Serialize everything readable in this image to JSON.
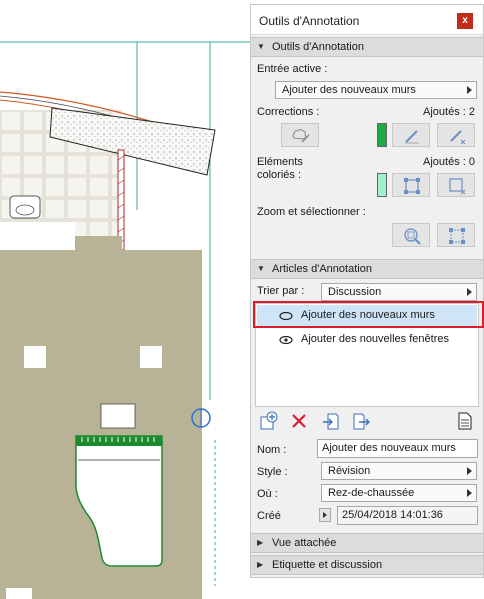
{
  "palette": {
    "title": "Outils d'Annotation",
    "close_label": "x"
  },
  "tools_section": {
    "header": "Outils d'Annotation",
    "active_entry_label": "Entrée active :",
    "active_entry_value": "Ajouter des nouveaux murs",
    "corrections_label": "Corrections :",
    "corrections_count": "Ajoutés : 2",
    "corrections_swatch_color": "#1faa4a",
    "colored_elements_label_line1": "Eléments",
    "colored_elements_label_line2": "coloriés :",
    "colored_elements_count": "Ajoutés : 0",
    "colored_swatch_color": "#9ef0c8",
    "zoom_select_label": "Zoom et sélectionner :"
  },
  "items_section": {
    "header": "Articles d'Annotation",
    "sort_by_label": "Trier par :",
    "sort_by_value": "Discussion",
    "items": [
      {
        "label": "Ajouter des nouveaux murs",
        "selected": true
      },
      {
        "label": "Ajouter des nouvelles  fenêtres",
        "selected": false
      }
    ],
    "highlight_color": "#d81e28"
  },
  "details": {
    "name_label": "Nom :",
    "name_value": "Ajouter des nouveaux murs",
    "style_label": "Style :",
    "style_value": "Révision",
    "where_label": "Où :",
    "where_value": "Rez-de-chaussée",
    "created_label": "Créé",
    "created_value": "25/04/2018 14:01:36"
  },
  "collapsed_sections": {
    "attached_view": "Vue attachée",
    "label_discussion": "Etiquette et discussion"
  },
  "icons": {
    "new_item": "new-annotation-icon",
    "delete": "delete-x-icon",
    "import": "import-icon",
    "export": "export-icon",
    "report": "report-document-icon"
  }
}
